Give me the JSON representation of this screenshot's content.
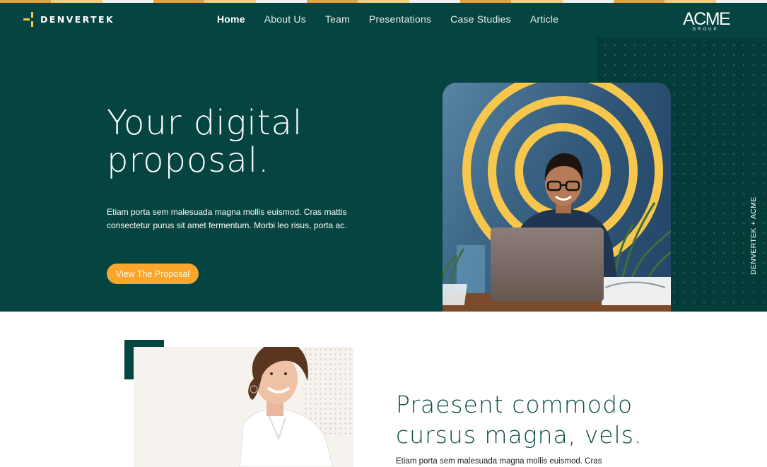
{
  "colors": {
    "brand_dark_green": "#054440",
    "panel_darker_green": "#033c38",
    "accent_orange": "#f9a62b",
    "accent_yellow": "#f7c648",
    "cream": "#f6f3ef",
    "heading_green": "#0b4b45"
  },
  "top_stripe": [
    "#e8a23c",
    "#f2cf7a",
    "#f2f2f2",
    "#e8a23c",
    "#f2cf7a",
    "#f2f2f2",
    "#e8a23c",
    "#f2cf7a",
    "#f2f2f2",
    "#e8a23c",
    "#f2cf7a",
    "#f2f2f2",
    "#e8a23c",
    "#f2cf7a",
    "#f2f2f2"
  ],
  "header": {
    "logo_text": "DENVERTEK",
    "logo_icon": "crosshair-mark-icon",
    "nav": [
      {
        "label": "Home",
        "active": true
      },
      {
        "label": "About Us",
        "active": false
      },
      {
        "label": "Team",
        "active": false
      },
      {
        "label": "Presentations",
        "active": false
      },
      {
        "label": "Case Studies",
        "active": false
      },
      {
        "label": "Article",
        "active": false
      }
    ],
    "partner_logo": {
      "name": "ACME",
      "sub": "GROUP"
    }
  },
  "hero": {
    "title_line1": "Your digital",
    "title_line2": "proposal.",
    "body": "Etiam porta sem malesuada magna mollis euismod. Cras mattis consectetur purus sit amet fermentum. Morbi leo risus, porta ac.",
    "cta_label": "View The Proposal",
    "image_alt": "Woman with glasses smiling at laptop in front of yellow concentric circles",
    "vertical_caption": "DENVERTEK + ACME"
  },
  "section2": {
    "image_alt": "Smiling woman with short hair in white shirt",
    "title_line1": "Praesent commodo",
    "title_line2": "cursus magna, vels.",
    "body": "Etiam porta sem malesuada magna mollis euismod. Cras"
  }
}
